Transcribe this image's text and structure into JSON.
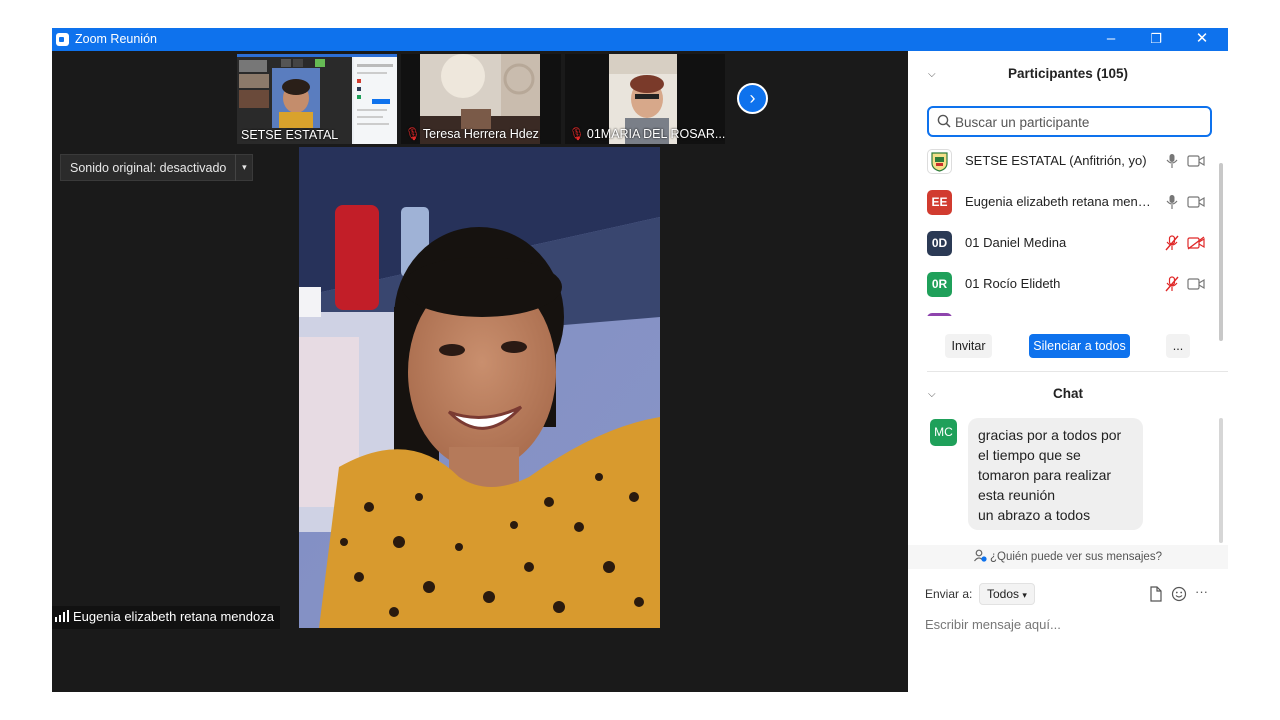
{
  "window": {
    "title": "Zoom Reunión",
    "minimize": "–",
    "restore": "❐",
    "close": "✕"
  },
  "thumbnails": [
    {
      "name": "SETSE ESTATAL",
      "muted": false
    },
    {
      "name": "Teresa Herrera Hdez",
      "muted": true
    },
    {
      "name": "01MARIA DEL ROSAR...",
      "muted": true
    }
  ],
  "next_glyph": "›",
  "original_sound": {
    "label": "Sonido original: desactivado",
    "dropdown_glyph": "▾"
  },
  "speaker": {
    "name": "Eugenia elizabeth retana mendoza"
  },
  "participants": {
    "header": "Participantes (105)",
    "search_placeholder": "Buscar un participante",
    "rows": [
      {
        "initials": "",
        "name": "SETSE ESTATAL (Anfitrión, yo)",
        "color": "#ffffff",
        "mic": "on",
        "cam": "on"
      },
      {
        "initials": "EE",
        "name": "Eugenia elizabeth retana mendoza",
        "color": "#d13b2f",
        "mic": "on",
        "cam": "on"
      },
      {
        "initials": "0D",
        "name": "01 Daniel Medina",
        "color": "#2b3a55",
        "mic": "muted",
        "cam": "off"
      },
      {
        "initials": "0R",
        "name": "01 Rocío Elideth",
        "color": "#1fa05a",
        "mic": "muted",
        "cam": "on"
      },
      {
        "initials": "",
        "name": "",
        "color": "#8e44ad",
        "mic": "muted",
        "cam": "on"
      }
    ],
    "invite_label": "Invitar",
    "mute_all_label": "Silenciar a todos",
    "more_label": "..."
  },
  "chat": {
    "header": "Chat",
    "messages": [
      {
        "initials": "MC",
        "color": "#1fa05a",
        "lines": [
          "gracias por a todos por",
          "el tiempo que se",
          "tomaron para realizar",
          "esta reunión",
          "un abrazo a todos"
        ]
      }
    ],
    "who_can_see": "¿Quién puede ver sus mensajes?",
    "send_to_label": "Enviar a:",
    "recipient": "Todos",
    "input_placeholder": "Escribir mensaje aquí...",
    "more_glyph": "···"
  },
  "colors": {
    "accent": "#0e72ed",
    "muted_red": "#e02828",
    "stage_bg": "#1a1a1a"
  }
}
